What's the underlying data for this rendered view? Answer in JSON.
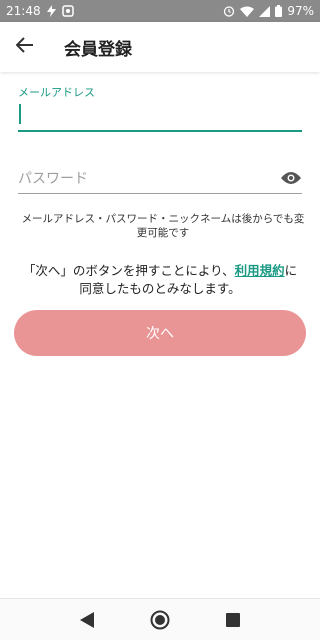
{
  "status_bar": {
    "time": "21:48",
    "battery": "97%",
    "icons": [
      "flash-icon",
      "notification-icon",
      "alarm-icon",
      "wifi-icon",
      "signal-icon",
      "battery-icon"
    ]
  },
  "header": {
    "title": "会員登録",
    "back_icon": "arrow-back-icon"
  },
  "form": {
    "email_label": "メールアドレス",
    "email_value": "",
    "password_placeholder": "パスワード",
    "password_visibility_icon": "eye-icon",
    "helper_text": "メールアドレス・パスワード・ニックネームは後からでも変更可能です"
  },
  "consent": {
    "prefix": "「次へ」のボタンを押すことにより、",
    "link_text": "利用規約",
    "suffix": "に同意したものとみなします。"
  },
  "next_button": {
    "label": "次へ"
  },
  "nav": {
    "back": "back-triangle-icon",
    "home": "home-circle-icon",
    "recents": "recents-square-icon"
  },
  "colors": {
    "accent": "#1a9a84",
    "button": "#e99595",
    "status_bar": "#8a8a8a"
  }
}
